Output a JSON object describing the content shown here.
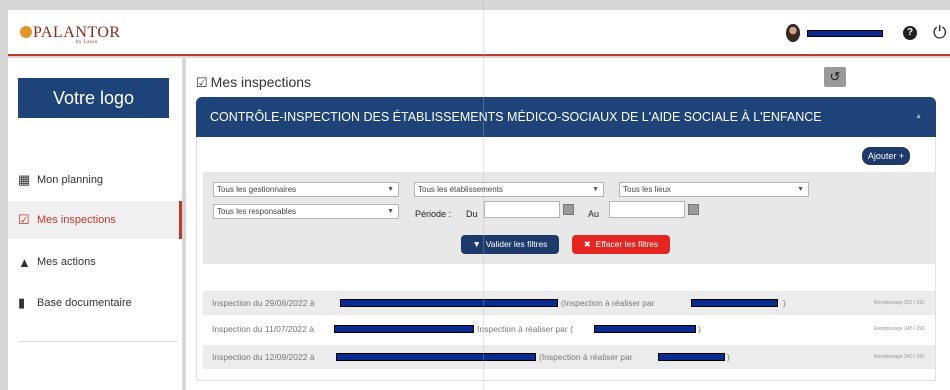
{
  "header": {
    "logo_text": "PALANTOR",
    "logo_sub": "by Lasso",
    "user_name_redacted": ""
  },
  "sidebar": {
    "logo_button": "Votre logo",
    "items": [
      {
        "label": "Mon planning",
        "icon": "calendar-icon",
        "active": false
      },
      {
        "label": "Mes inspections",
        "icon": "checkbox-icon",
        "active": true
      },
      {
        "label": "Mes actions",
        "icon": "warning-icon",
        "active": false
      },
      {
        "label": "Base documentaire",
        "icon": "document-icon",
        "active": false
      }
    ]
  },
  "main": {
    "title": "Mes inspections",
    "panel_title": "CONTRÔLE-INSPECTION DES ÉTABLISSEMENTS MÉDICO-SOCIAUX DE L'AIDE SOCIALE À L'ENFANCE",
    "add_button": "Ajouter +",
    "filters": {
      "gestionnaires": "Tous les gestionnaires",
      "etablissements": "Tous les établissements",
      "lieux": "Tous les lieux",
      "responsables": "Tous les responsables",
      "periode_label": "Période :",
      "du_label": "Du",
      "au_label": "Au",
      "valider": "Valider les filtres",
      "effacer": "Effacer les filtres"
    },
    "rows": [
      {
        "prefix": "Inspection du 29/06/2022 à",
        "middle": "(Inspection à réaliser par",
        "suffix": ")",
        "fill": "Remplissage 291 / 291"
      },
      {
        "prefix": "Inspection du 11/07/2022 à",
        "middle": "Inspection à réaliser par (",
        "suffix": ")",
        "fill": "Remplissage 245 / 291"
      },
      {
        "prefix": "Inspection du 12/09/2022 à",
        "middle": "(Inspection à réaliser par",
        "suffix": ")",
        "fill": "Remplissage 240 / 291"
      }
    ]
  },
  "colors": {
    "brand_red": "#c0392b",
    "navy": "#1e4378",
    "danger": "#e5251f",
    "redaction": "#0a2a8f"
  }
}
